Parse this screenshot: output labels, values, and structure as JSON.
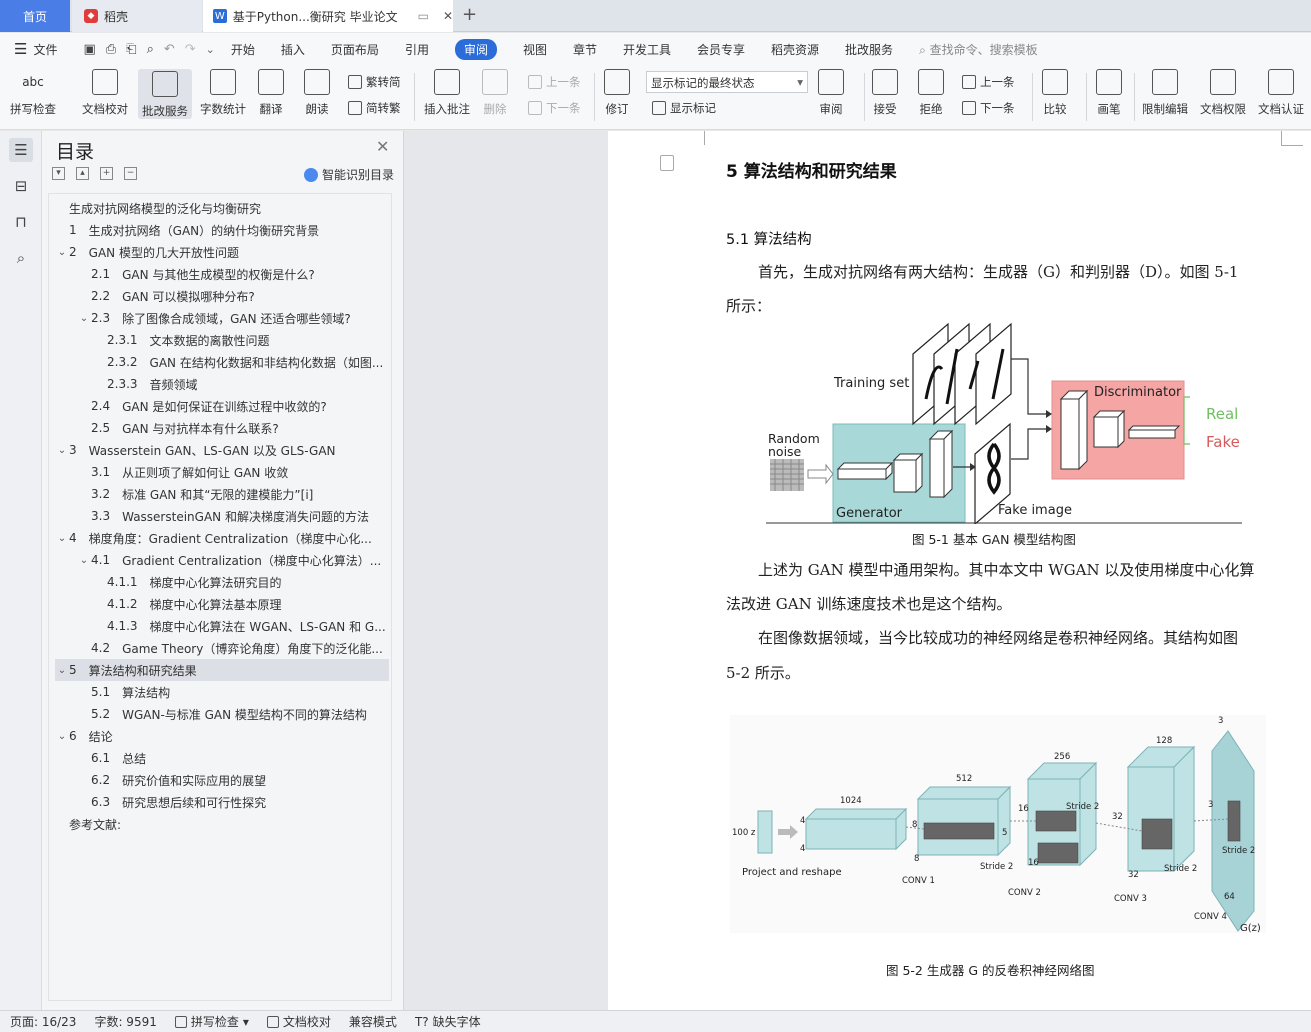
{
  "tabs": {
    "home": "首页",
    "daoke": "稻壳",
    "doc": "基于Python...衡研究 毕业论文"
  },
  "menu": {
    "file": "文件",
    "items": [
      "开始",
      "插入",
      "页面布局",
      "引用",
      "审阅",
      "视图",
      "章节",
      "开发工具",
      "会员专享",
      "稻壳资源",
      "批改服务"
    ],
    "active": "审阅",
    "search": "查找命令、搜索模板"
  },
  "ribbon": {
    "spell": "拼写检查",
    "proof": "文档校对",
    "correct": "批改服务",
    "count": "字数统计",
    "translate": "翻译",
    "read": "朗读",
    "tosimp": "繁转简",
    "totrad": "简转繁",
    "insert_comment": "插入批注",
    "delete": "删除",
    "prev_c": "上一条",
    "next_c": "下一条",
    "revise": "修订",
    "markup_state": "显示标记的最终状态",
    "show_markup": "显示标记",
    "review": "审阅",
    "accept": "接受",
    "reject": "拒绝",
    "prev": "上一条",
    "next": "下一条",
    "compare": "比较",
    "pen": "画笔",
    "restrict": "限制编辑",
    "rights": "文档权限",
    "verify": "文档认证"
  },
  "toc": {
    "title": "目录",
    "smart": "智能识别目录",
    "items": [
      {
        "num": "",
        "text": "生成对抗网络模型的泛化与均衡研究",
        "level": 0,
        "chev": ""
      },
      {
        "num": "1",
        "text": "生成对抗网络（GAN）的纳什均衡研究背景",
        "level": 1,
        "chev": ""
      },
      {
        "num": "2",
        "text": "GAN 模型的几大开放性问题",
        "level": 1,
        "chev": "v"
      },
      {
        "num": "2.1",
        "text": "GAN 与其他生成模型的权衡是什么?",
        "level": 2,
        "chev": ""
      },
      {
        "num": "2.2",
        "text": "GAN 可以模拟哪种分布?",
        "level": 2,
        "chev": ""
      },
      {
        "num": "2.3",
        "text": "除了图像合成领域，GAN 还适合哪些领域?",
        "level": 2,
        "chev": "v"
      },
      {
        "num": "2.3.1",
        "text": "文本数据的离散性问题",
        "level": 3,
        "chev": ""
      },
      {
        "num": "2.3.2",
        "text": "GAN 在结构化数据和非结构化数据（如图...",
        "level": 3,
        "chev": ""
      },
      {
        "num": "2.3.3",
        "text": "音频领域",
        "level": 3,
        "chev": ""
      },
      {
        "num": "2.4",
        "text": "GAN 是如何保证在训练过程中收敛的?",
        "level": 2,
        "chev": ""
      },
      {
        "num": "2.5",
        "text": "GAN 与对抗样本有什么联系?",
        "level": 2,
        "chev": ""
      },
      {
        "num": "3",
        "text": "Wasserstein GAN、LS-GAN 以及 GLS-GAN",
        "level": 1,
        "chev": "v"
      },
      {
        "num": "3.1",
        "text": "从正则项了解如何让 GAN 收敛",
        "level": 2,
        "chev": ""
      },
      {
        "num": "3.2",
        "text": "标准 GAN 和其“无限的建模能力”[i]",
        "level": 2,
        "chev": ""
      },
      {
        "num": "3.3",
        "text": "WassersteinGAN 和解决梯度消失问题的方法",
        "level": 2,
        "chev": ""
      },
      {
        "num": "4",
        "text": "梯度角度：Gradient Centralization（梯度中心化...",
        "level": 1,
        "chev": "v"
      },
      {
        "num": "4.1",
        "text": "Gradient Centralization（梯度中心化算法）...",
        "level": 2,
        "chev": "v"
      },
      {
        "num": "4.1.1",
        "text": "梯度中心化算法研究目的",
        "level": 3,
        "chev": ""
      },
      {
        "num": "4.1.2",
        "text": "梯度中心化算法基本原理",
        "level": 3,
        "chev": ""
      },
      {
        "num": "4.1.3",
        "text": "梯度中心化算法在 WGAN、LS-GAN 和 G...",
        "level": 3,
        "chev": ""
      },
      {
        "num": "4.2",
        "text": "Game Theory（博弈论角度）角度下的泛化能...",
        "level": 2,
        "chev": ""
      },
      {
        "num": "5",
        "text": "算法结构和研究结果",
        "level": 1,
        "chev": "v"
      },
      {
        "num": "5.1",
        "text": "算法结构",
        "level": 2,
        "chev": ""
      },
      {
        "num": "5.2",
        "text": "WGAN-与标准 GAN 模型结构不同的算法结构",
        "level": 2,
        "chev": ""
      },
      {
        "num": "6",
        "text": "结论",
        "level": 1,
        "chev": "v"
      },
      {
        "num": "6.1",
        "text": "总结",
        "level": 2,
        "chev": ""
      },
      {
        "num": "6.2",
        "text": "研究价值和实际应用的展望",
        "level": 2,
        "chev": ""
      },
      {
        "num": "6.3",
        "text": "研究思想后续和可行性探究",
        "level": 2,
        "chev": ""
      },
      {
        "num": "",
        "text": "参考文献:",
        "level": 0,
        "chev": ""
      }
    ],
    "selected_index": 21
  },
  "doc": {
    "h1": "5    算法结构和研究结果",
    "h2": "5.1    算法结构",
    "p1a": "首先，生成对抗网络有两大结构：生成器（G）和判别器（D）。如图 5-1",
    "p1b": "所示：",
    "fig1": {
      "training": "Training set",
      "random1": "Random",
      "random2": "noise",
      "disc": "Discriminator",
      "real": "Real",
      "fake": "Fake",
      "gen": "Generator",
      "fake_image": "Fake image"
    },
    "cap1": "图 5-1    基本 GAN 模型结构图",
    "p2a": "上述为 GAN 模型中通用架构。其中本文中 WGAN 以及使用梯度中心化算",
    "p2b": "法改进 GAN 训练速度技术也是这个结构。",
    "p3a": "在图像数据领域，当今比较成功的神经网络是卷积神经网络。其结构如图",
    "p3b": "5-2 所示。",
    "fig2": {
      "z": "100 z",
      "proj": "Project and reshape",
      "n1024": "1024",
      "n512": "512",
      "n256": "256",
      "n128": "128",
      "n3": "3",
      "n64": "64",
      "n4a": "4",
      "n4b": "4",
      "n8a": "8",
      "n8b": "8",
      "n16a": "16",
      "n16b": "16",
      "n32a": "32",
      "n32b": "32",
      "n64b": "64",
      "n5": "5",
      "stride": "Stride 2",
      "conv1": "CONV 1",
      "conv2": "CONV 2",
      "conv3": "CONV 3",
      "conv4": "CONV 4",
      "gz": "G(z)"
    },
    "cap2": "图 5-2    生成器 G 的反卷积神经网络图"
  },
  "status": {
    "page": "页面: 16/23",
    "words": "字数: 9591",
    "spell": "拼写检查",
    "proof": "文档校对",
    "compat": "兼容模式",
    "font": "缺失字体"
  }
}
